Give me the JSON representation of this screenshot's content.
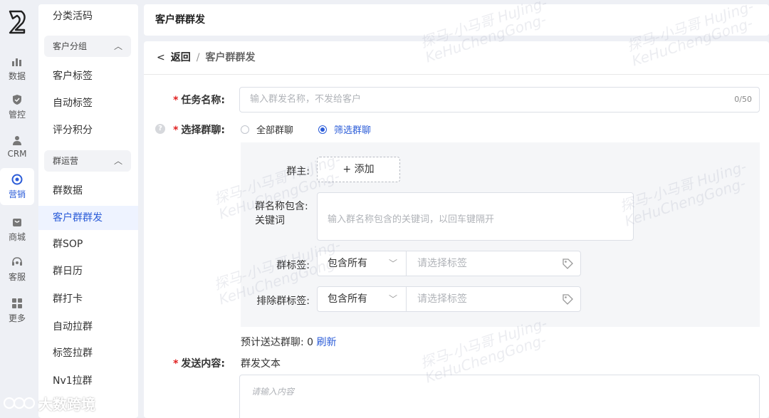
{
  "rail": {
    "items": [
      {
        "label": "数据",
        "icon": "chart-icon"
      },
      {
        "label": "管控",
        "icon": "shield-icon"
      },
      {
        "label": "CRM",
        "icon": "person-icon"
      },
      {
        "label": "营销",
        "icon": "target-icon"
      },
      {
        "label": "商城",
        "icon": "shop-icon"
      },
      {
        "label": "客服",
        "icon": "headset-icon"
      },
      {
        "label": "更多",
        "icon": "grid-icon"
      }
    ],
    "active_index": 3
  },
  "submenu": {
    "top_item": "分类活码",
    "group1": "客户分组",
    "group1_items": [
      "客户标签",
      "自动标签",
      "评分积分"
    ],
    "group2": "群运营",
    "group2_items": [
      "群数据",
      "客户群群发",
      "群SOP",
      "群日历",
      "群打卡",
      "自动拉群",
      "标签拉群",
      "Nv1拉群"
    ],
    "active": "客户群群发"
  },
  "header": {
    "title": "客户群群发"
  },
  "breadcrumb": {
    "back": "返回",
    "separator": "/",
    "current": "客户群群发"
  },
  "form": {
    "task_name_label": "任务名称:",
    "task_name_placeholder": "输入群发名称，不发给客户",
    "task_name_counter": "0/50",
    "select_group_label": "选择群聊:",
    "radio_all": "全部群聊",
    "radio_filter": "筛选群聊",
    "radio_selected": "筛选群聊",
    "owner_label": "群主:",
    "add_button": "+ 添加",
    "keyword_label_1": "群名称包含:",
    "keyword_label_2": "关键词",
    "keyword_placeholder": "输入群名称包含的关键词，以回车键隔开",
    "tag_label": "群标签:",
    "tag_mode": "包含所有",
    "tag_placeholder": "请选择标签",
    "exclude_tag_label": "排除群标签:",
    "exclude_tag_mode": "包含所有",
    "exclude_tag_placeholder": "请选择标签",
    "estimate_label": "预计送达群聊:",
    "estimate_count": "0",
    "refresh_label": "刷新",
    "content_label": "发送内容:",
    "content_type": "群发文本",
    "content_placeholder": "请输入内容"
  },
  "watermark": {
    "line1": "探马-小马哥 HuJing-",
    "line2": "KeHuChengGong-"
  },
  "brand": {
    "text": "大数跨境"
  },
  "colors": {
    "accent": "#2b5cd8",
    "required": "#e02020",
    "filter_bg": "#f5f6f8"
  }
}
